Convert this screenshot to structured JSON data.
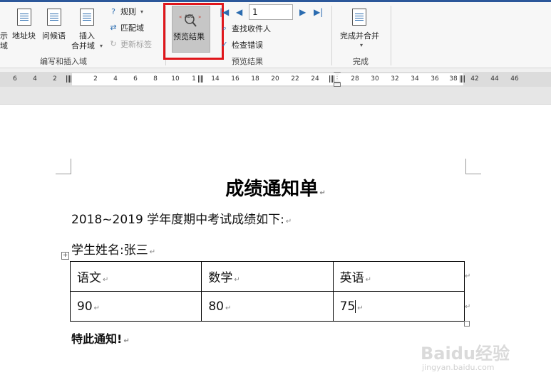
{
  "ribbon": {
    "write_insert": {
      "show_fields_partial": "示",
      "show_fields_partial_2": "域",
      "address_block": "地址块",
      "greeting_line": "问候语",
      "insert_merge_field_line1": "插入",
      "insert_merge_field_line2": "合并域",
      "rules": "规则",
      "match_fields": "匹配域",
      "update_labels": "更新标签",
      "group_label": "编写和插入域"
    },
    "preview": {
      "preview_results": "预览结果",
      "record_number": "1",
      "find_recipient": "查找收件人",
      "check_errors": "检查错误",
      "group_label": "预览结果"
    },
    "finish": {
      "finish_merge": "完成并合并",
      "group_label": "完成"
    }
  },
  "ruler": {
    "left_numbers": [
      "6",
      "4",
      "2"
    ],
    "numbers": [
      "2",
      "4",
      "6",
      "8",
      "10",
      "1",
      "14",
      "16",
      "18",
      "20",
      "22",
      "24"
    ],
    "right_numbers": [
      "28",
      "30",
      "32",
      "34",
      "36",
      "38",
      "42",
      "44",
      "46"
    ]
  },
  "document": {
    "title": "成绩通知单",
    "line1": "2018~2019 学年度期中考试成绩如下:",
    "student_name": "学生姓名:张三",
    "table": {
      "headers": [
        "语文",
        "数学",
        "英语"
      ],
      "values": [
        "90",
        "80",
        "75"
      ]
    },
    "closing": "特此通知!"
  },
  "watermark": {
    "brand": "Baidu经验",
    "url": "jingyan.baidu.com"
  },
  "colors": {
    "accent": "#2b579a",
    "highlight": "#e0161b"
  }
}
